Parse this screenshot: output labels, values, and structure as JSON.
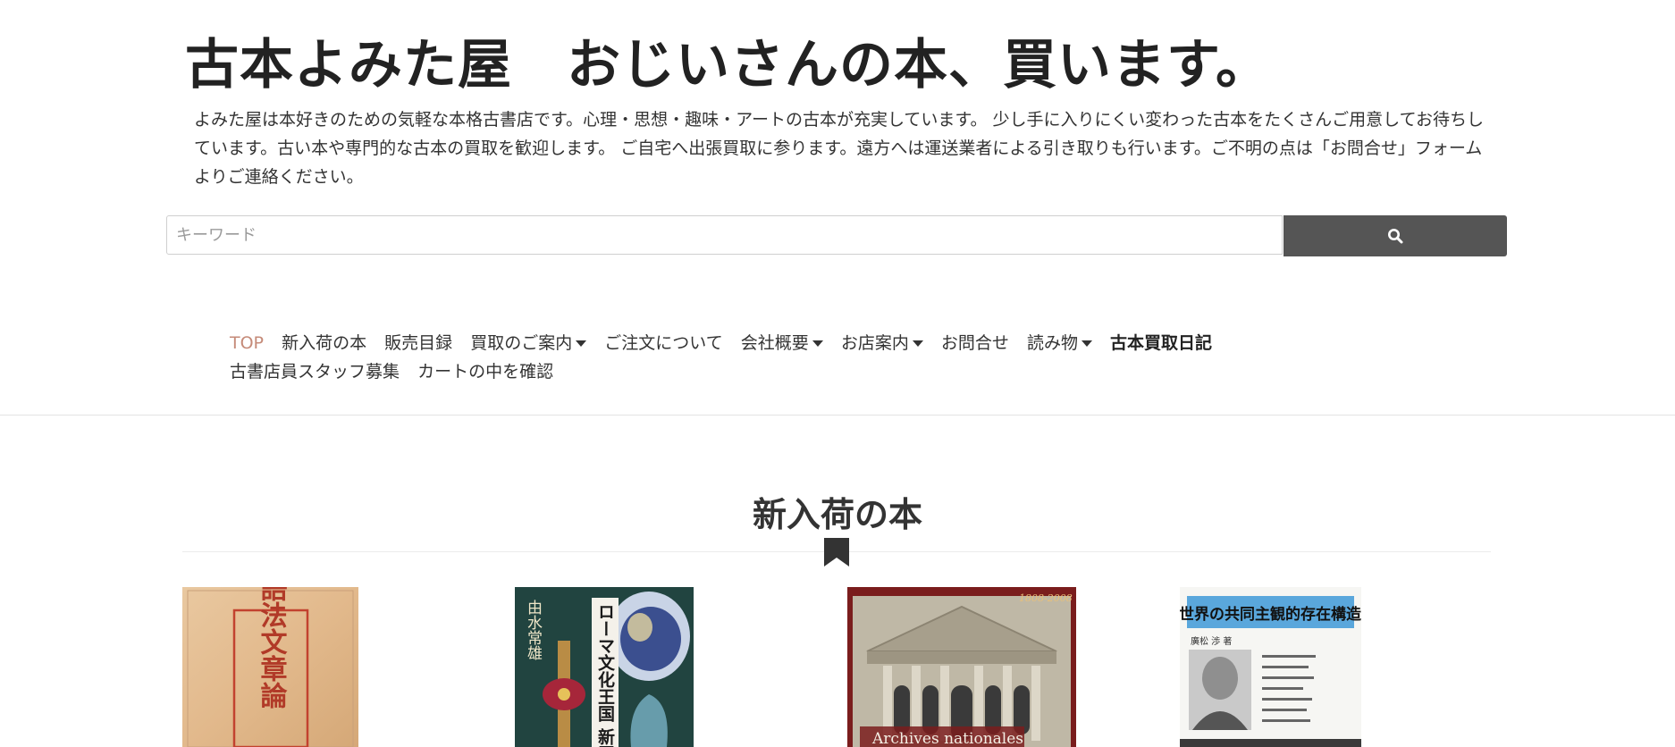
{
  "header": {
    "site_title": "古本よみた屋　おじいさんの本、買います。",
    "description": "よみた屋は本好きのための気軽な本格古書店です。心理・思想・趣味・アートの古本が充実しています。 少し手に入りにくい変わった古本をたくさんご用意してお待ちしています。古い本や専門的な古本の買取を歓迎します。 ご自宅へ出張買取に参ります。遠方へは運送業者による引き取りも行います。ご不明の点は「お問合せ」フォームよりご連絡ください。"
  },
  "search": {
    "placeholder": "キーワード",
    "value": "",
    "button_icon": "search-icon"
  },
  "nav": {
    "items": [
      {
        "label": "TOP",
        "dropdown": false,
        "active": true
      },
      {
        "label": "新入荷の本",
        "dropdown": false
      },
      {
        "label": "販売目録",
        "dropdown": false
      },
      {
        "label": "買取のご案内",
        "dropdown": true
      },
      {
        "label": "ご注文について",
        "dropdown": false
      },
      {
        "label": "会社概要",
        "dropdown": true
      },
      {
        "label": "お店案内",
        "dropdown": true
      },
      {
        "label": "お問合せ",
        "dropdown": false
      },
      {
        "label": "読み物",
        "dropdown": true
      },
      {
        "label": "古本買取日記",
        "dropdown": false,
        "bold": true
      },
      {
        "label": "古書店員スタッフ募集",
        "dropdown": false
      },
      {
        "label": "カートの中を確認",
        "dropdown": false
      }
    ],
    "active_color": "#c58a78"
  },
  "new_arrivals": {
    "title": "新入荷の本",
    "icon": "bookmark-icon",
    "books": [
      {
        "cover_text": [
          "國語法文章論"
        ]
      },
      {
        "cover_text": [
          "ローマ文化王国 新羅",
          "由水常雄"
        ]
      },
      {
        "cover_text": [
          "1808-2008",
          "Archives nationales"
        ]
      },
      {
        "cover_text": [
          "世界の共同主観的存在構造",
          "廣松 渉 著"
        ]
      }
    ]
  },
  "colors": {
    "search_button": "#555555",
    "text": "#222222"
  }
}
